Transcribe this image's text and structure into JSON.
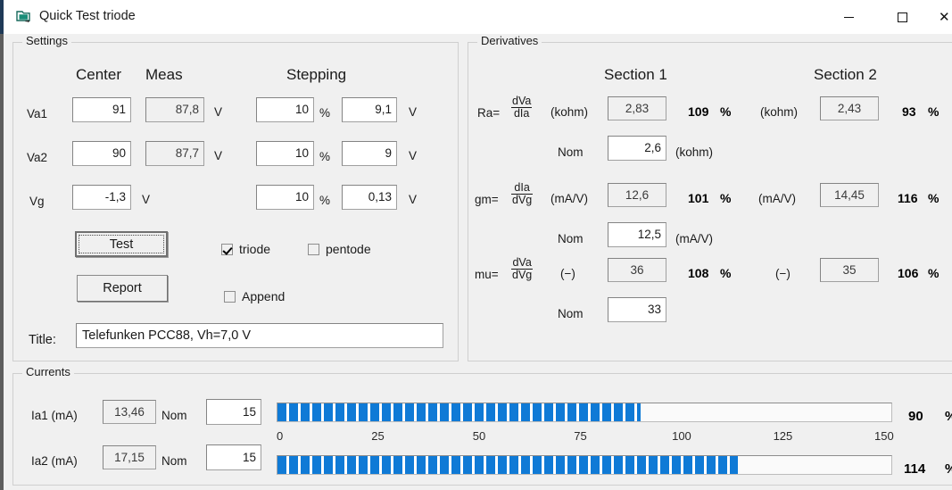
{
  "window": {
    "title": "Quick Test triode",
    "icon": "folder-window-icon",
    "minimize_label": "—",
    "maximize_label": "□",
    "close_label": "✕"
  },
  "settings": {
    "legend": "Settings",
    "col_center": "Center",
    "col_meas": "Meas",
    "col_stepping": "Stepping",
    "rows": [
      {
        "name": "Va1",
        "center": "91",
        "meas": "87,8",
        "meas_unit": "V",
        "step_pct": "10",
        "pct_symbol": "%",
        "step_val": "9,1",
        "step_unit": "V"
      },
      {
        "name": "Va2",
        "center": "90",
        "meas": "87,7",
        "meas_unit": "V",
        "step_pct": "10",
        "pct_symbol": "%",
        "step_val": "9",
        "step_unit": "V"
      },
      {
        "name": "Vg",
        "center": "-1,3",
        "meas": "",
        "meas_unit": "V",
        "step_pct": "10",
        "pct_symbol": "%",
        "step_val": "0,13",
        "step_unit": "V"
      }
    ],
    "test_button": "Test",
    "report_button": "Report",
    "triode_label": "triode",
    "triode_checked": true,
    "pentode_label": "pentode",
    "pentode_checked": false,
    "append_label": "Append",
    "append_checked": false,
    "title_label": "Title:",
    "title_value": "Telefunken PCC88, Vh=7,0 V"
  },
  "derivatives": {
    "legend": "Derivatives",
    "section1": "Section 1",
    "section2": "Section 2",
    "percent_symbol": "%",
    "ra": {
      "symbol": "Ra=",
      "num": "dVa",
      "den": "dIa",
      "unit1": "(kohm)",
      "value1": "2,83",
      "pct1": "109",
      "unit2": "(kohm)",
      "value2": "2,43",
      "pct2": "93",
      "nom_label": "Nom",
      "nom_value": "2,6",
      "nom_unit": "(kohm)"
    },
    "gm": {
      "symbol": "gm=",
      "num": "dIa",
      "den": "dVg",
      "unit1": "(mA/V)",
      "value1": "12,6",
      "pct1": "101",
      "unit2": "(mA/V)",
      "value2": "14,45",
      "pct2": "116",
      "nom_label": "Nom",
      "nom_value": "12,5",
      "nom_unit": "(mA/V)"
    },
    "mu": {
      "symbol": "mu=",
      "num": "dVa",
      "den": "dVg",
      "unit1": "(−)",
      "value1": "36",
      "pct1": "108",
      "unit2": "(−)",
      "value2": "35",
      "pct2": "106",
      "nom_label": "Nom",
      "nom_value": "33",
      "nom_unit": ""
    }
  },
  "currents": {
    "legend": "Currents",
    "percent_symbol": "%",
    "rows": [
      {
        "label": "Ia1 (mA)",
        "value": "13,46",
        "nom_label": "Nom",
        "nom_value": "15",
        "pct": "90"
      },
      {
        "label": "Ia2 (mA)",
        "value": "17,15",
        "nom_label": "Nom",
        "nom_value": "15",
        "pct": "114"
      }
    ],
    "scale_ticks": [
      "0",
      "25",
      "50",
      "75",
      "100",
      "125",
      "150"
    ],
    "scale_min": 0,
    "scale_max": 152,
    "bar1_value": 90,
    "bar2_value": 114
  },
  "colors": {
    "progress_blue": "#0f7ad6",
    "window_bg": "#f0f0f0",
    "titlebar_bg": "#ffffff",
    "field_border": "#a0a0a0",
    "icon_teal": "#1a7a6a"
  }
}
